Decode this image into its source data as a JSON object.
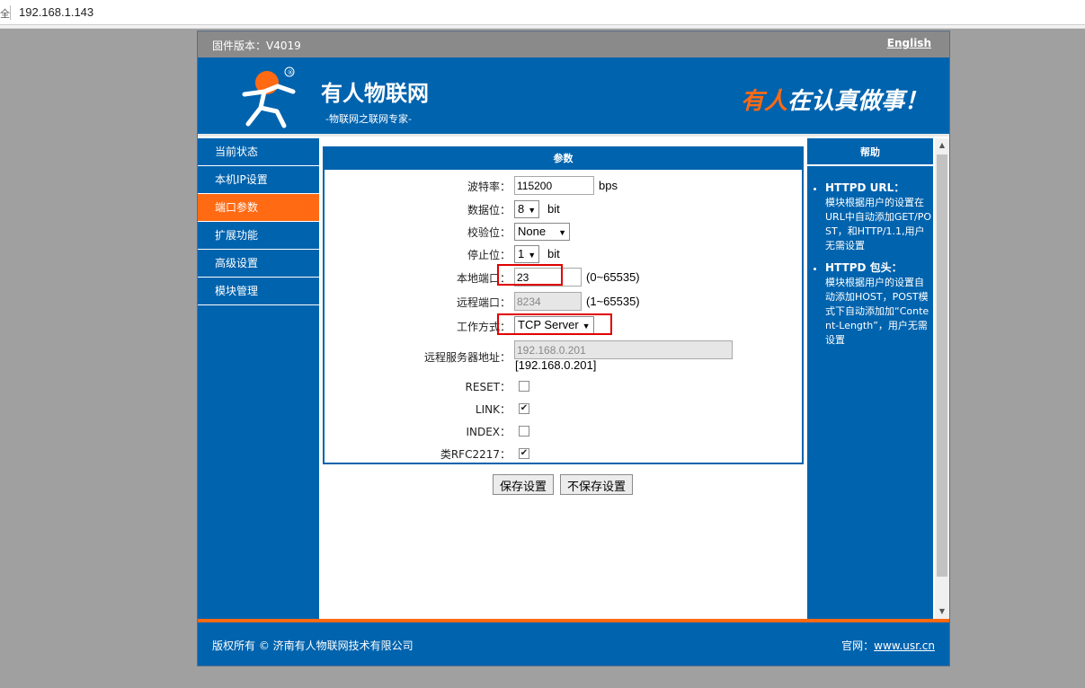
{
  "browser": {
    "url": "192.168.1.143",
    "lock_glyph": "全"
  },
  "topbar": {
    "firmware": "固件版本：V4019",
    "language_link": "English"
  },
  "header": {
    "brand": "有人物联网",
    "tagline": "-物联网之联网专家-",
    "slogan_orange": "有人",
    "slogan_white": "在认真做事！",
    "registered": "®"
  },
  "nav": {
    "items": [
      {
        "label": "当前状态"
      },
      {
        "label": "本机IP设置"
      },
      {
        "label": "端口参数"
      },
      {
        "label": "扩展功能"
      },
      {
        "label": "高级设置"
      },
      {
        "label": "模块管理"
      }
    ],
    "active_index": 2
  },
  "params": {
    "title": "参数",
    "baud": {
      "label": "波特率：",
      "value": "115200",
      "unit": "bps"
    },
    "databits": {
      "label": "数据位：",
      "value": "8",
      "unit": "bit"
    },
    "parity": {
      "label": "校验位：",
      "value": "None"
    },
    "stopbits": {
      "label": "停止位：",
      "value": "1",
      "unit": "bit"
    },
    "local_port": {
      "label": "本地端口：",
      "value": "23",
      "range": "(0~65535)"
    },
    "remote_port": {
      "label": "远程端口：",
      "value": "8234",
      "range": "(1~65535)"
    },
    "work_mode": {
      "label": "工作方式：",
      "value": "TCP Server"
    },
    "remote_server": {
      "label": "远程服务器地址：",
      "value": "192.168.0.201",
      "echo": "[192.168.0.201]"
    },
    "reset": {
      "label": "RESET：",
      "checked": false
    },
    "link": {
      "label": "LINK：",
      "checked": true
    },
    "index": {
      "label": "INDEX：",
      "checked": false
    },
    "rfc2217": {
      "label": "类RFC2217：",
      "checked": true
    }
  },
  "buttons": {
    "save": "保存设置",
    "nosave": "不保存设置"
  },
  "help": {
    "title": "帮助",
    "items": [
      {
        "heading": "HTTPD URL：",
        "text": "模块根据用户的设置在URL中自动添加GET/POST，和HTTP/1.1,用户无需设置"
      },
      {
        "heading": "HTTPD 包头：",
        "text": "模块根据用户的设置自动添加HOST，POST模式下自动添加加“Content-Length”，用户无需设置"
      }
    ]
  },
  "footer": {
    "copyright": "版权所有 © 济南有人物联网技术有限公司",
    "site_label": "官网：",
    "site_link": "www.usr.cn"
  },
  "colors": {
    "blue": "#0063ae",
    "orange": "#ff6a13",
    "gray_bar": "#8a8a8a",
    "highlight_red": "#e00000"
  }
}
